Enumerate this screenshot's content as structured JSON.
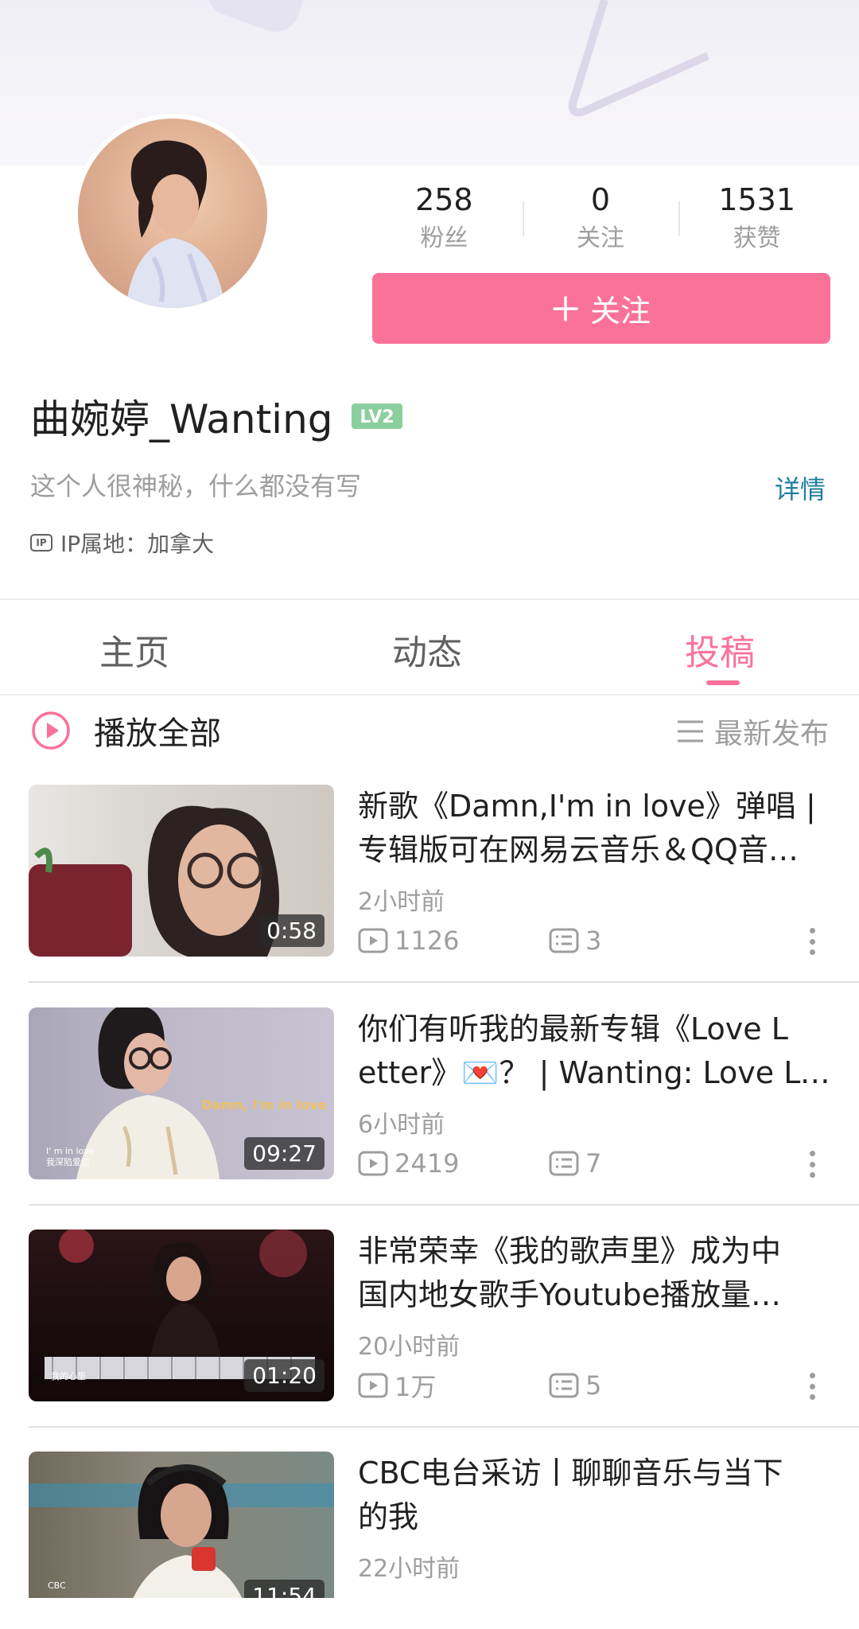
{
  "profile": {
    "stats": [
      {
        "value": "258",
        "label": "粉丝"
      },
      {
        "value": "0",
        "label": "关注"
      },
      {
        "value": "1531",
        "label": "获赞"
      }
    ],
    "follow_label": "关注",
    "name": "曲婉婷_Wanting",
    "level": "LV2",
    "bio": "这个人很神秘，什么都没有写",
    "detail_label": "详情",
    "ip_icon": "IP",
    "ip_text": "IP属地：加拿大"
  },
  "tabs": [
    {
      "label": "主页"
    },
    {
      "label": "动态"
    },
    {
      "label": "投稿"
    }
  ],
  "active_tab": "投稿",
  "list_header": {
    "play_all": "播放全部",
    "sort": "最新发布"
  },
  "videos": [
    {
      "title_line1": "新歌《Damn,I'm in love》弹唱 |",
      "title_line2": "专辑版可在网易云音乐＆QQ音…",
      "duration": "0:58",
      "time": "2小时前",
      "plays": "1126",
      "comments": "3"
    },
    {
      "title_line1": "你们有听我的最新专辑《Love L",
      "title_line2": "etter》💌？ | Wanting: Love Le…",
      "duration": "09:27",
      "time": "6小时前",
      "plays": "2419",
      "comments": "7",
      "thumb_caption": "Damn, I'm in love",
      "thumb_sub1": "I' m in love",
      "thumb_sub2": "我深陷爱恋"
    },
    {
      "title_line1": "非常荣幸《我的歌声里》成为中",
      "title_line2": "国内地女歌手Youtube播放量…",
      "duration": "01:20",
      "time": "20小时前",
      "plays": "1万",
      "comments": "5",
      "thumb_sub1": "我的心里"
    },
    {
      "title_line1": "CBC电台采访丨聊聊音乐与当下",
      "title_line2": "的我",
      "duration": "11:54",
      "time": "22小时前",
      "thumb_sub1": "CBC"
    }
  ],
  "colors": {
    "accent": "#fb7299",
    "link": "#1e7fa1",
    "level": "#8ccf9e"
  }
}
